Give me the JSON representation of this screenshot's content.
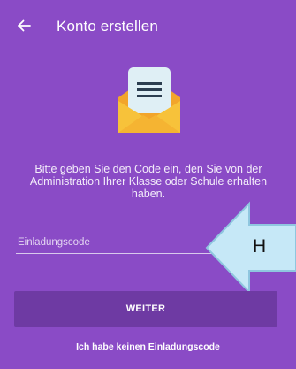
{
  "header": {
    "title": "Konto erstellen",
    "back_icon": "arrow-left-icon"
  },
  "illustration": {
    "icon": "envelope-letter-icon"
  },
  "message": "Bitte geben Sie den Code ein, den Sie von der Administration Ihrer Klasse oder Schule erhalten haben.",
  "form": {
    "code_label": "Einladungscode",
    "code_value": ""
  },
  "callout": {
    "text": "H",
    "icon": "arrow-left-icon",
    "color": "#c6e8f7"
  },
  "actions": {
    "continue_label": "WEITER",
    "no_code_label": "Ich habe keinen Einladungscode"
  },
  "colors": {
    "background": "#8a4bc6",
    "button": "#6e3aa3",
    "envelope": "#f7c23a",
    "envelope_flap": "#f2a52b",
    "paper": "#dfeff5"
  }
}
